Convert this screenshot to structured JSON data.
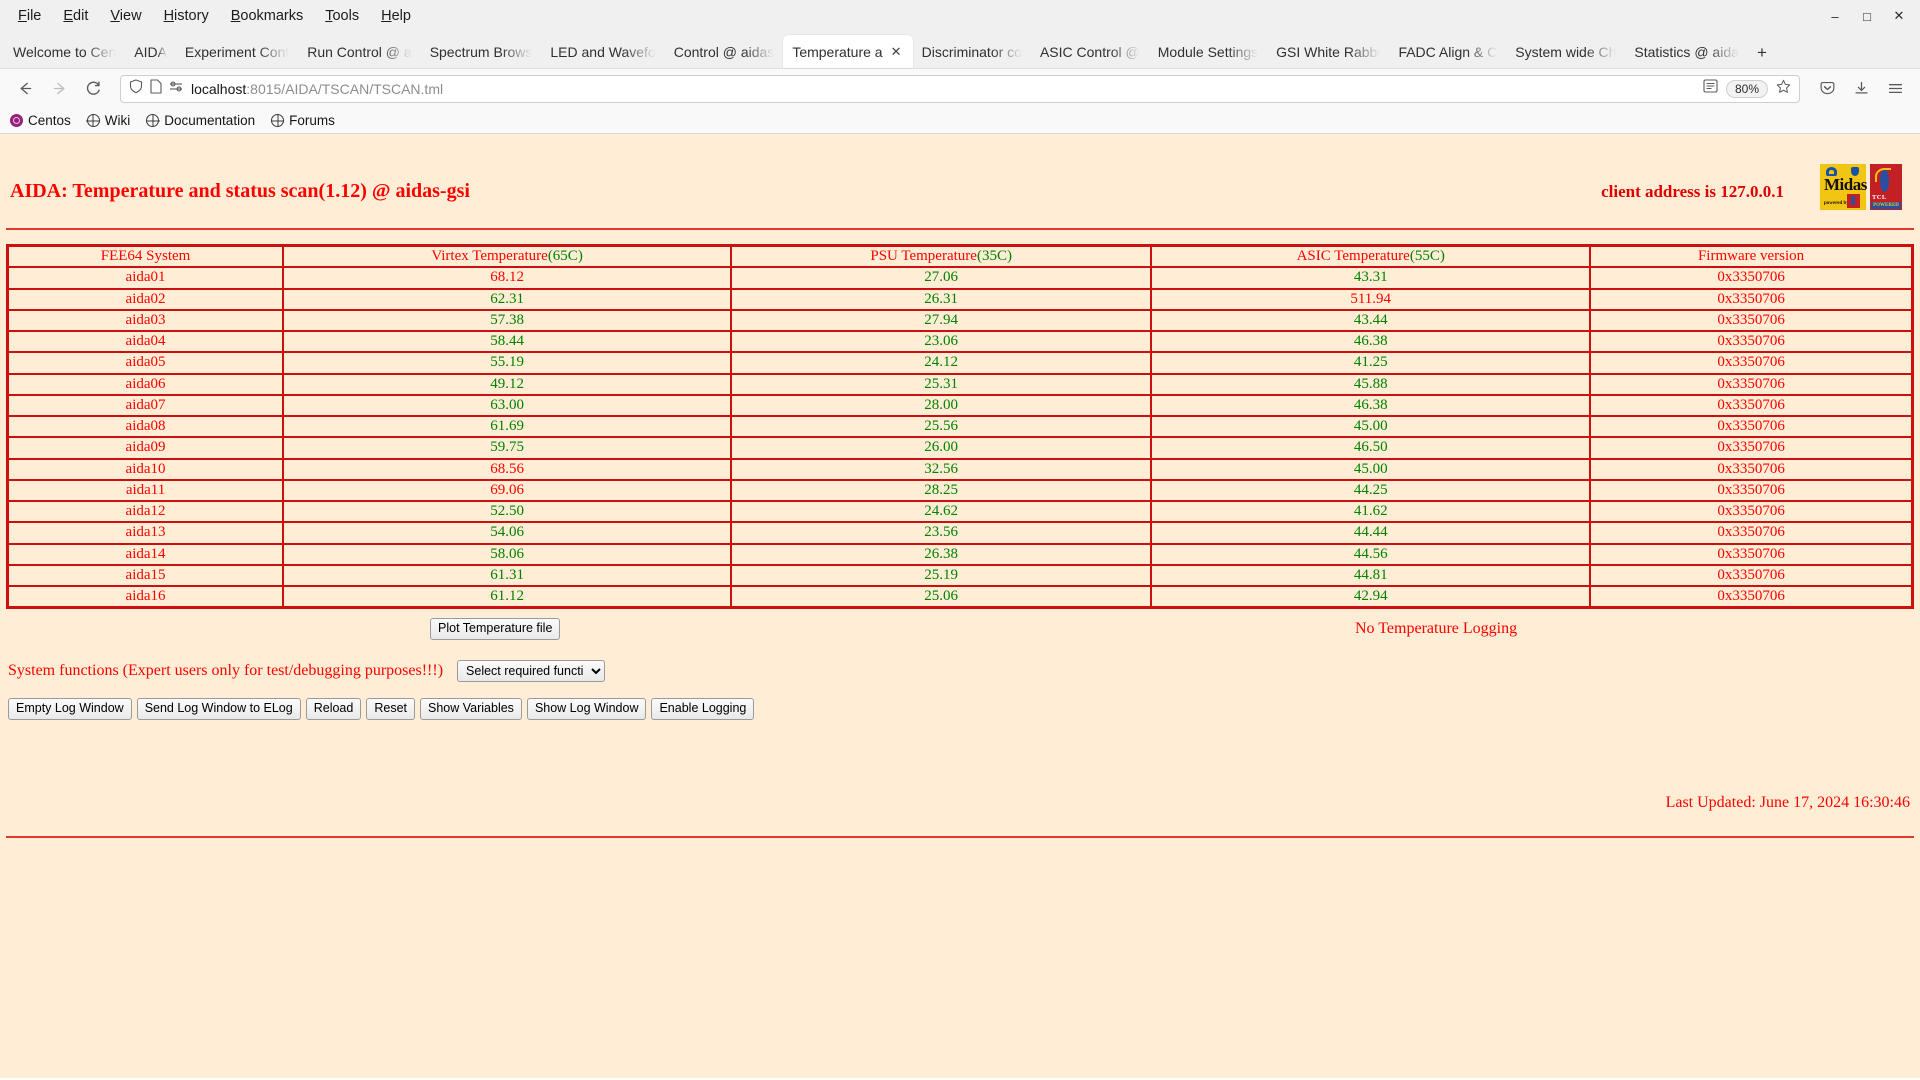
{
  "browser": {
    "menus": [
      "File",
      "Edit",
      "View",
      "History",
      "Bookmarks",
      "Tools",
      "Help"
    ],
    "window_controls": {
      "minimize": "–",
      "maximize": "□",
      "close": "✕"
    },
    "tabs": [
      {
        "label": "Welcome to Cen",
        "active": false
      },
      {
        "label": "AIDA",
        "active": false
      },
      {
        "label": "Experiment Cont",
        "active": false
      },
      {
        "label": "Run Control @ a",
        "active": false
      },
      {
        "label": "Spectrum Brows",
        "active": false
      },
      {
        "label": "LED and Wavefo",
        "active": false
      },
      {
        "label": "Control @ aidas",
        "active": false
      },
      {
        "label": "Temperature a",
        "active": true
      },
      {
        "label": "Discriminator co",
        "active": false
      },
      {
        "label": "ASIC Control @",
        "active": false
      },
      {
        "label": "Module Settings",
        "active": false
      },
      {
        "label": "GSI White Rabbi",
        "active": false
      },
      {
        "label": "FADC Align & C",
        "active": false
      },
      {
        "label": "System wide Ch",
        "active": false
      },
      {
        "label": "Statistics @ aida",
        "active": false
      }
    ],
    "new_tab_label": "+",
    "nav": {
      "back": "←",
      "forward": "→",
      "reload": "⟳"
    },
    "url": {
      "scheme_host": "localhost",
      "rest": ":8015/AIDA/TSCAN/TSCAN.tml"
    },
    "zoom_level": "80%",
    "bookmarks": [
      {
        "label": "Centos",
        "icon": "centos-icon"
      },
      {
        "label": "Wiki",
        "icon": "globe-icon"
      },
      {
        "label": "Documentation",
        "icon": "globe-icon"
      },
      {
        "label": "Forums",
        "icon": "globe-icon"
      }
    ]
  },
  "page": {
    "title": "AIDA: Temperature and status scan(1.12) @ aidas-gsi",
    "client_address": "client address is 127.0.0.1",
    "logos": {
      "midas": {
        "text": "idas",
        "initial": "M",
        "powered_by": "powered by"
      },
      "tcl": {
        "text": "TCL",
        "band": "POWERED"
      }
    },
    "table": {
      "headers": [
        {
          "main": "FEE64 System",
          "paren": ""
        },
        {
          "main": "Virtex Temperature",
          "paren": "(65C)"
        },
        {
          "main": "PSU Temperature",
          "paren": "(35C)"
        },
        {
          "main": "ASIC Temperature",
          "paren": "(55C)"
        },
        {
          "main": "Firmware version",
          "paren": ""
        }
      ],
      "rows": [
        {
          "system": "aida01",
          "virtex": "68.12",
          "virtex_hot": true,
          "psu": "27.06",
          "psu_hot": false,
          "asic": "43.31",
          "asic_hot": false,
          "fw": "0x3350706"
        },
        {
          "system": "aida02",
          "virtex": "62.31",
          "virtex_hot": false,
          "psu": "26.31",
          "psu_hot": false,
          "asic": "511.94",
          "asic_hot": true,
          "fw": "0x3350706"
        },
        {
          "system": "aida03",
          "virtex": "57.38",
          "virtex_hot": false,
          "psu": "27.94",
          "psu_hot": false,
          "asic": "43.44",
          "asic_hot": false,
          "fw": "0x3350706"
        },
        {
          "system": "aida04",
          "virtex": "58.44",
          "virtex_hot": false,
          "psu": "23.06",
          "psu_hot": false,
          "asic": "46.38",
          "asic_hot": false,
          "fw": "0x3350706"
        },
        {
          "system": "aida05",
          "virtex": "55.19",
          "virtex_hot": false,
          "psu": "24.12",
          "psu_hot": false,
          "asic": "41.25",
          "asic_hot": false,
          "fw": "0x3350706"
        },
        {
          "system": "aida06",
          "virtex": "49.12",
          "virtex_hot": false,
          "psu": "25.31",
          "psu_hot": false,
          "asic": "45.88",
          "asic_hot": false,
          "fw": "0x3350706"
        },
        {
          "system": "aida07",
          "virtex": "63.00",
          "virtex_hot": false,
          "psu": "28.00",
          "psu_hot": false,
          "asic": "46.38",
          "asic_hot": false,
          "fw": "0x3350706"
        },
        {
          "system": "aida08",
          "virtex": "61.69",
          "virtex_hot": false,
          "psu": "25.56",
          "psu_hot": false,
          "asic": "45.00",
          "asic_hot": false,
          "fw": "0x3350706"
        },
        {
          "system": "aida09",
          "virtex": "59.75",
          "virtex_hot": false,
          "psu": "26.00",
          "psu_hot": false,
          "asic": "46.50",
          "asic_hot": false,
          "fw": "0x3350706"
        },
        {
          "system": "aida10",
          "virtex": "68.56",
          "virtex_hot": true,
          "psu": "32.56",
          "psu_hot": false,
          "asic": "45.00",
          "asic_hot": false,
          "fw": "0x3350706"
        },
        {
          "system": "aida11",
          "virtex": "69.06",
          "virtex_hot": true,
          "psu": "28.25",
          "psu_hot": false,
          "asic": "44.25",
          "asic_hot": false,
          "fw": "0x3350706"
        },
        {
          "system": "aida12",
          "virtex": "52.50",
          "virtex_hot": false,
          "psu": "24.62",
          "psu_hot": false,
          "asic": "41.62",
          "asic_hot": false,
          "fw": "0x3350706"
        },
        {
          "system": "aida13",
          "virtex": "54.06",
          "virtex_hot": false,
          "psu": "23.56",
          "psu_hot": false,
          "asic": "44.44",
          "asic_hot": false,
          "fw": "0x3350706"
        },
        {
          "system": "aida14",
          "virtex": "58.06",
          "virtex_hot": false,
          "psu": "26.38",
          "psu_hot": false,
          "asic": "44.56",
          "asic_hot": false,
          "fw": "0x3350706"
        },
        {
          "system": "aida15",
          "virtex": "61.31",
          "virtex_hot": false,
          "psu": "25.19",
          "psu_hot": false,
          "asic": "44.81",
          "asic_hot": false,
          "fw": "0x3350706"
        },
        {
          "system": "aida16",
          "virtex": "61.12",
          "virtex_hot": false,
          "psu": "25.06",
          "psu_hot": false,
          "asic": "42.94",
          "asic_hot": false,
          "fw": "0x3350706"
        }
      ]
    },
    "plot_button": "Plot Temperature file",
    "logging_status": "No Temperature Logging",
    "system_functions_label": "System functions (Expert users only for test/debugging purposes!!!)",
    "system_functions_select": {
      "selected": "Select required function",
      "options": [
        "Select required function"
      ]
    },
    "action_buttons": [
      "Empty Log Window",
      "Send Log Window to ELog",
      "Reload",
      "Reset",
      "Show Variables",
      "Show Log Window",
      "Enable Logging"
    ],
    "last_updated": "Last Updated: June 17, 2024 16:30:46"
  },
  "colors": {
    "page_bg": "#ffeed5",
    "red": "#ff0000",
    "green": "#008000",
    "border_red": "#cc1010"
  }
}
